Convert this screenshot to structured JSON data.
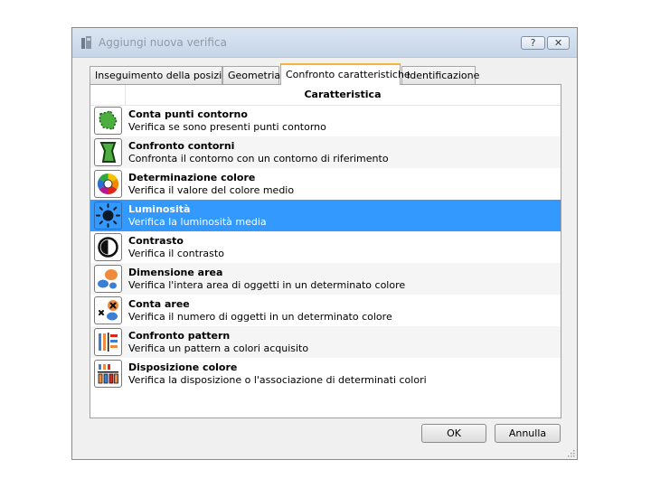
{
  "window": {
    "title": "Aggiungi nuova verifica",
    "help_label": "?",
    "close_label": "✕"
  },
  "tabs": [
    {
      "label": "Inseguimento della posizione"
    },
    {
      "label": "Geometria"
    },
    {
      "label": "Confronto caratteristiche",
      "active": true
    },
    {
      "label": "Identificazione"
    }
  ],
  "table": {
    "header": "Caratteristica",
    "rows": [
      {
        "icon": "contour-points-icon",
        "name": "Conta punti contorno",
        "desc": "Verifica se sono presenti punti contorno"
      },
      {
        "icon": "contour-compare-icon",
        "name": "Confronto contorni",
        "desc": "Confronta il contorno con un contorno di riferimento"
      },
      {
        "icon": "color-wheel-icon",
        "name": "Determinazione colore",
        "desc": "Verifica il valore del colore medio"
      },
      {
        "icon": "sun-icon",
        "name": "Luminosità",
        "desc": "Verifica la luminosità media",
        "selected": true
      },
      {
        "icon": "contrast-icon",
        "name": "Contrasto",
        "desc": "Verifica il contrasto"
      },
      {
        "icon": "area-size-icon",
        "name": "Dimensione area",
        "desc": "Verifica l'intera area di oggetti in un determinato colore"
      },
      {
        "icon": "count-areas-icon",
        "name": "Conta aree",
        "desc": "Verifica il numero di oggetti in un determinato colore"
      },
      {
        "icon": "pattern-compare-icon",
        "name": "Confronto pattern",
        "desc": "Verifica un pattern a colori acquisito"
      },
      {
        "icon": "color-arrangement-icon",
        "name": "Disposizione colore",
        "desc": "Verifica la disposizione o l'associazione di determinati colori"
      }
    ]
  },
  "buttons": {
    "ok": "OK",
    "cancel": "Annulla"
  },
  "colors": {
    "selection": "#3399ff",
    "active_tab_accent": "#f3b53c"
  }
}
